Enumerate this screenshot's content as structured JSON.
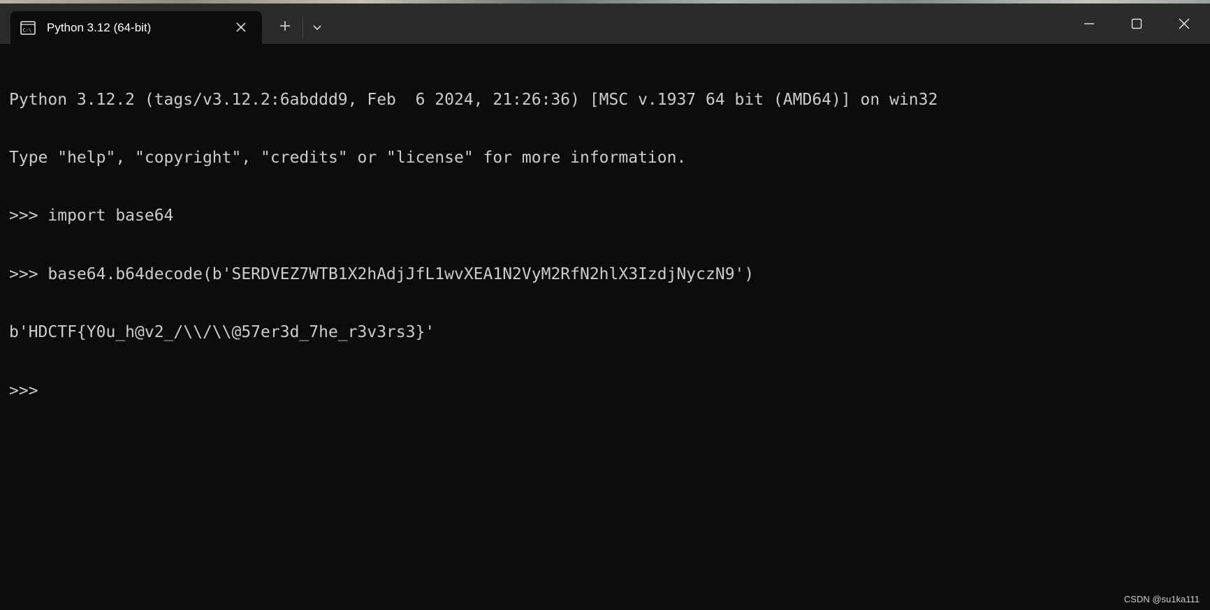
{
  "window": {
    "tab_title": "Python 3.12 (64-bit)",
    "icons": {
      "tab": "terminal-icon",
      "close_tab": "close-icon",
      "new_tab": "plus-icon",
      "dropdown": "chevron-down-icon",
      "minimize": "minimize-icon",
      "maximize": "maximize-icon",
      "close_window": "close-icon"
    },
    "colors": {
      "titlebar": "#2b2b2b",
      "console_bg": "#0c0c0c",
      "console_text": "#cccccc"
    }
  },
  "console": {
    "lines": [
      "Python 3.12.2 (tags/v3.12.2:6abddd9, Feb  6 2024, 21:26:36) [MSC v.1937 64 bit (AMD64)] on win32",
      "Type \"help\", \"copyright\", \"credits\" or \"license\" for more information.",
      ">>> import base64",
      ">>> base64.b64decode(b'SERDVEZ7WTB1X2hAdjJfL1wvXEA1N2VyM2RfN2hlX3IzdjNyczN9')",
      "b'HDCTF{Y0u_h@v2_/\\\\/\\\\@57er3d_7he_r3v3rs3}'",
      ">>> "
    ]
  },
  "watermark": "CSDN @su1ka111"
}
